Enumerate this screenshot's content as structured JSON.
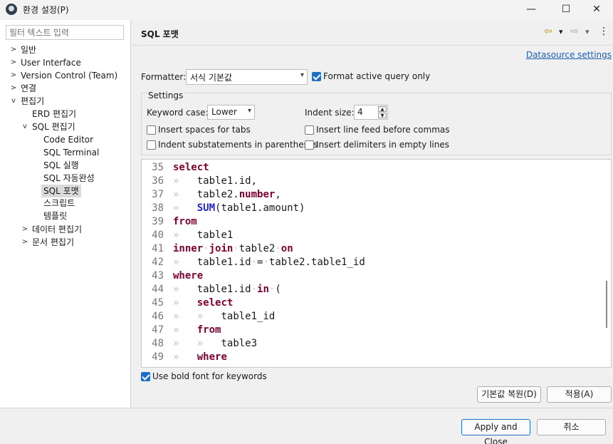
{
  "window": {
    "title": "환경 설정(P)",
    "minimize": "—",
    "maximize": "☐",
    "close": "✕"
  },
  "sidebar": {
    "filter_placeholder": "필터 텍스트 입력",
    "items": [
      {
        "label": "일반",
        "twisty": ">"
      },
      {
        "label": "User Interface",
        "twisty": ">"
      },
      {
        "label": "Version Control (Team)",
        "twisty": ">"
      },
      {
        "label": "연결",
        "twisty": ">"
      },
      {
        "label": "편집기",
        "twisty": "v"
      },
      {
        "label": "ERD 편집기",
        "twisty": ""
      },
      {
        "label": "SQL 편집기",
        "twisty": "v"
      },
      {
        "label": "Code Editor",
        "twisty": ""
      },
      {
        "label": "SQL Terminal",
        "twisty": ""
      },
      {
        "label": "SQL 실행",
        "twisty": ""
      },
      {
        "label": "SQL 자동완성",
        "twisty": ""
      },
      {
        "label": "SQL 포맷",
        "twisty": ""
      },
      {
        "label": "스크립트",
        "twisty": ""
      },
      {
        "label": "템플릿",
        "twisty": ""
      },
      {
        "label": "데이터 편집기",
        "twisty": ">"
      },
      {
        "label": "문서 편집기",
        "twisty": ">"
      }
    ]
  },
  "page": {
    "title": "SQL 포맷",
    "nav_back_icon": "⇦",
    "nav_forward_icon": "⇨",
    "nav_dropdown": "▾",
    "menu_icon": "⋮",
    "datasource_link": "Datasource settings",
    "formatter_label": "Formatter:",
    "formatter_value": "서식 기본값",
    "format_active_label": "Format active query only",
    "settings_title": "Settings",
    "keyword_case_label": "Keyword case:",
    "keyword_case_value": "Lower",
    "indent_size_label": "Indent size:",
    "indent_size_value": "4",
    "options": {
      "insert_spaces": "Insert spaces for tabs",
      "indent_sub": "Indent substatements in parentheses",
      "line_feed_commas": "Insert line feed before commas",
      "delimiters_empty": "Insert delimiters in empty lines"
    },
    "bold_keywords_label": "Use bold font for keywords",
    "restore_defaults": "기본값 복원(D)",
    "apply": "적용(A)"
  },
  "code": {
    "line_numbers": [
      "35",
      "36",
      "37",
      "38",
      "39",
      "40",
      "41",
      "42",
      "43",
      "44",
      "45",
      "46",
      "47",
      "48",
      "49"
    ],
    "tab_glyph": "»",
    "space_glyph": "·",
    "tokens": {
      "select": "select",
      "from": "from",
      "where": "where",
      "inner": "inner",
      "join": "join",
      "on": "on",
      "in": "in",
      "sum": "SUM",
      "number": "number",
      "t1_id": "table1.id,",
      "table2": "table2.",
      "comma": ",",
      "amount": "(table1.amount)",
      "table1": "table1",
      "table2_plain": "table2",
      "t1_id_plain": "table1.id",
      "eq": "=",
      "t2_t1id": "table2.table1_id",
      "paren": "(",
      "table1_id": "table1_id",
      "table3": "table3"
    }
  },
  "footer": {
    "apply_close": "Apply and Close",
    "cancel": "취소"
  }
}
